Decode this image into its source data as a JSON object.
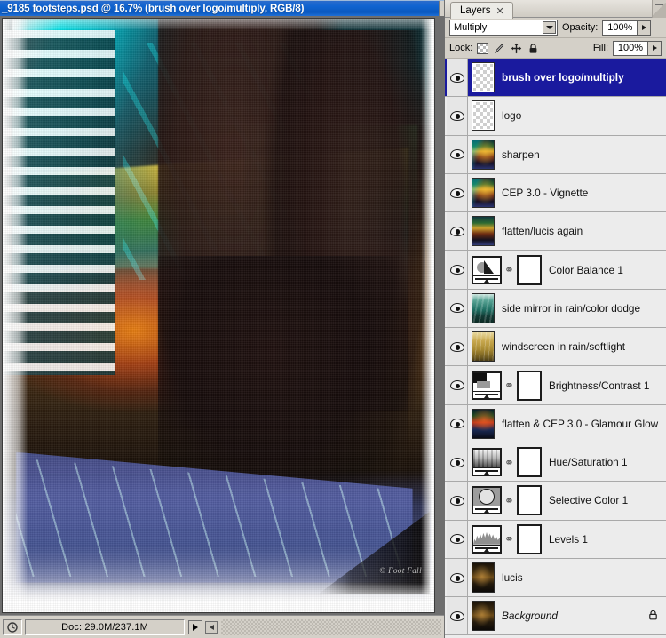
{
  "document_window": {
    "title": "_9185 footsteps.psd @ 16.7% (brush over logo/multiply, RGB/8)",
    "watermark": "© Foot Fall",
    "statusbar": {
      "clock_icon": "clock-icon",
      "doc_info": "Doc: 29.0M/237.1M",
      "play_icon": "play-triangle-icon",
      "back_icon": "back-arrow-icon"
    }
  },
  "layers_panel": {
    "tab": {
      "label": "Layers",
      "close": "✕"
    },
    "blend_mode": {
      "value": "Multiply",
      "arrow_icon": "chevron-down-icon"
    },
    "opacity": {
      "label": "Opacity:",
      "value": "100%",
      "stepper_icon": "stepper-arrow-icon"
    },
    "lock": {
      "label": "Lock:",
      "icons": [
        "lock-transparency-icon",
        "lock-image-brush-icon",
        "lock-position-move-icon",
        "lock-all-padlock-icon"
      ]
    },
    "fill": {
      "label": "Fill:",
      "value": "100%",
      "stepper_icon": "stepper-arrow-icon"
    },
    "layers": [
      {
        "name": "brush over logo/multiply",
        "selected": true,
        "visible": true,
        "thumb": "checker",
        "kind": "pixel"
      },
      {
        "name": "logo",
        "selected": false,
        "visible": true,
        "thumb": "checker",
        "kind": "pixel"
      },
      {
        "name": "sharpen",
        "selected": false,
        "visible": true,
        "thumb": "t-photo-a",
        "kind": "pixel"
      },
      {
        "name": "CEP 3.0 - Vignette",
        "selected": false,
        "visible": true,
        "thumb": "t-photo-a",
        "kind": "pixel"
      },
      {
        "name": "flatten/lucis again",
        "selected": false,
        "visible": true,
        "thumb": "t-photo-b",
        "kind": "pixel"
      },
      {
        "name": "Color Balance 1",
        "selected": false,
        "visible": true,
        "thumb": "g-colorbalance",
        "kind": "adjustment"
      },
      {
        "name": "side mirror in rain/color dodge",
        "selected": false,
        "visible": true,
        "thumb": "t-teal",
        "kind": "pixel"
      },
      {
        "name": "windscreen in rain/softlight",
        "selected": false,
        "visible": true,
        "thumb": "t-gold",
        "kind": "pixel"
      },
      {
        "name": "Brightness/Contrast 1",
        "selected": false,
        "visible": true,
        "thumb": "g-brightness",
        "kind": "adjustment"
      },
      {
        "name": "flatten & CEP 3.0 - Glamour Glow",
        "selected": false,
        "visible": true,
        "thumb": "t-glow",
        "kind": "pixel"
      },
      {
        "name": "Hue/Saturation 1",
        "selected": false,
        "visible": true,
        "thumb": "g-huesat",
        "kind": "adjustment"
      },
      {
        "name": "Selective Color 1",
        "selected": false,
        "visible": true,
        "thumb": "g-selective",
        "kind": "adjustment"
      },
      {
        "name": "Levels 1",
        "selected": false,
        "visible": true,
        "thumb": "g-levels",
        "kind": "adjustment"
      },
      {
        "name": "lucis",
        "selected": false,
        "visible": true,
        "thumb": "t-dark",
        "kind": "pixel"
      },
      {
        "name": "Background",
        "selected": false,
        "visible": true,
        "thumb": "t-dark",
        "kind": "background",
        "italic": true,
        "locked": true
      }
    ]
  },
  "colors": {
    "titlebar_blue": "#0a58bf",
    "selected_layer": "#1a1a9e",
    "panel_gray": "#d4d0c8",
    "list_gray": "#ececec"
  }
}
